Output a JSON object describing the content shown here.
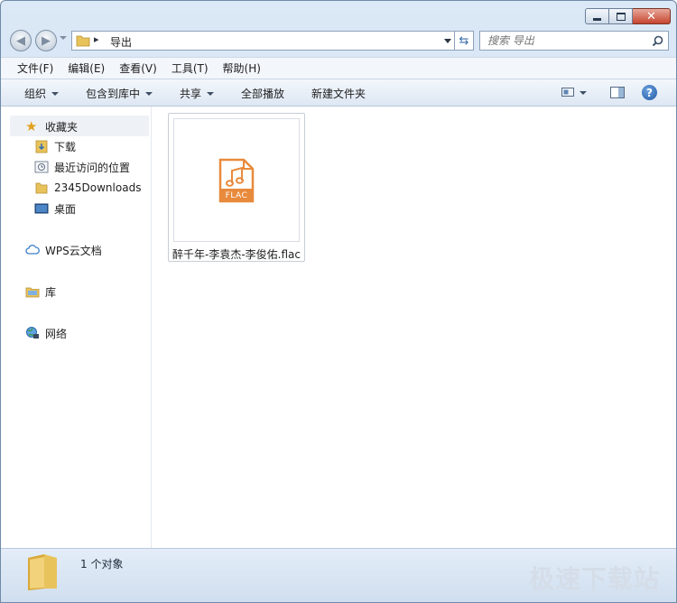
{
  "window": {
    "title": ""
  },
  "address": {
    "path": "导出",
    "separator": "▸"
  },
  "search": {
    "placeholder": "搜索 导出"
  },
  "menu": [
    "文件(F)",
    "编辑(E)",
    "查看(V)",
    "工具(T)",
    "帮助(H)"
  ],
  "toolbar": {
    "organize": "组织",
    "include_library": "包含到库中",
    "share": "共享",
    "play_all": "全部播放",
    "new_folder": "新建文件夹"
  },
  "sidebar": {
    "favorites": "收藏夹",
    "downloads": "下载",
    "recent": "最近访问的位置",
    "downloads2345": "2345Downloads",
    "desktop": "桌面",
    "wps": "WPS云文档",
    "library": "库",
    "network": "网络"
  },
  "file": {
    "name": "醉千年-李袁杰-李俊佑.flac",
    "badge": "FLAC"
  },
  "status": {
    "count": "1 个对象",
    "watermark": "极速下载站"
  },
  "colors": {
    "flac": "#e88a3c",
    "accent": "#2d6db5",
    "folder": "#e8c35c"
  }
}
